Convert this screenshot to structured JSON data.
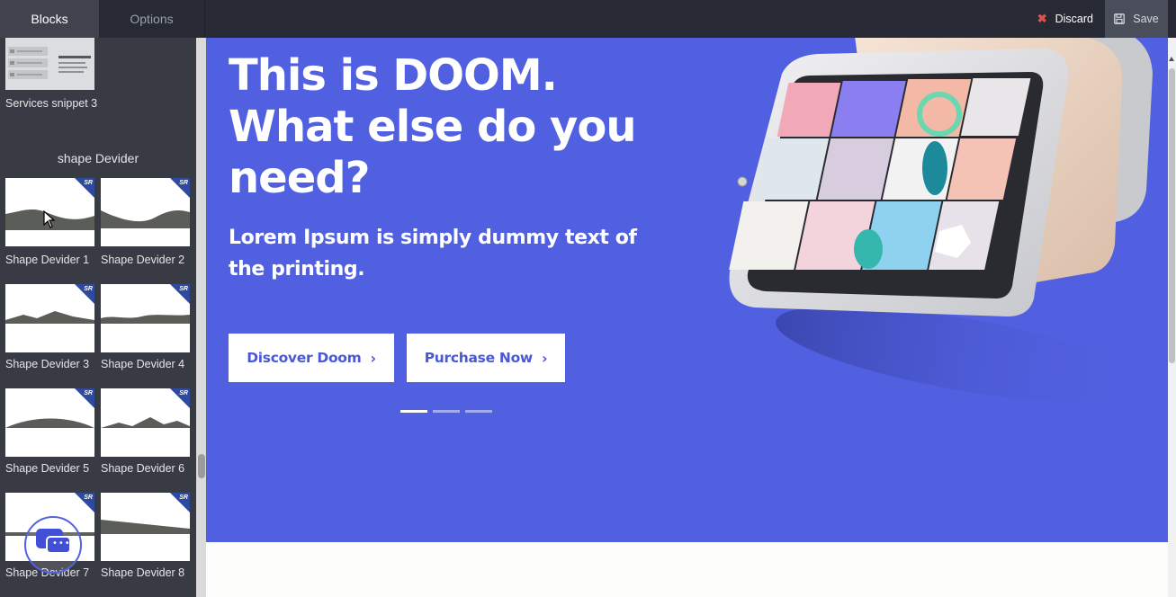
{
  "topbar": {
    "tabs": [
      {
        "label": "Blocks",
        "active": true
      },
      {
        "label": "Options",
        "active": false
      }
    ],
    "discard_label": "Discard",
    "save_label": "Save",
    "discard_icon": "close-icon",
    "save_icon": "floppy-disk-icon"
  },
  "sidebar": {
    "services_label": "Services snippet 3",
    "section_title": "shape Devider",
    "shapes": [
      {
        "label": "Shape Devider 1"
      },
      {
        "label": "Shape Devider 2"
      },
      {
        "label": "Shape Devider 3"
      },
      {
        "label": "Shape Devider 4"
      },
      {
        "label": "Shape Devider 5"
      },
      {
        "label": "Shape Devider 6"
      },
      {
        "label": "Shape Devider 7"
      },
      {
        "label": "Shape Devider 8"
      }
    ],
    "badge_text": "SR"
  },
  "hero": {
    "title_line1": "This is DOOM.",
    "title_line2": "What else do you",
    "title_line3": "need?",
    "subtitle": "Lorem Ipsum is simply dummy text of the printing.",
    "btn_discover": "Discover Doom",
    "btn_purchase": "Purchase Now",
    "chevron": "›",
    "slider_active_index": 0,
    "slider_count": 3
  },
  "colors": {
    "hero_bg": "#5160e0",
    "topbar_bg": "#272a35",
    "sidebar_bg": "#393b44",
    "accent_text": "#4a58d6",
    "discard_icon": "#d9534f"
  }
}
